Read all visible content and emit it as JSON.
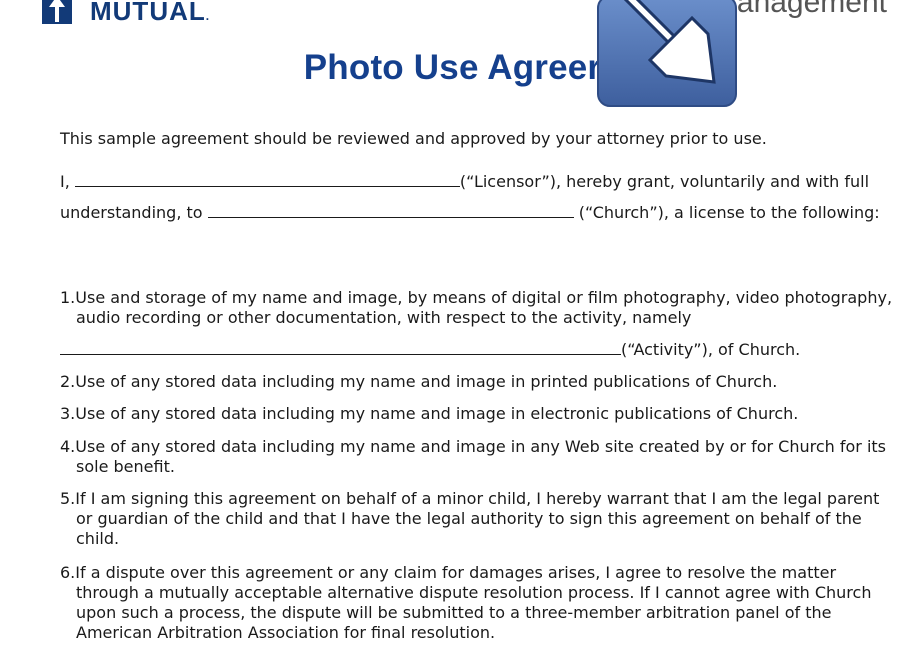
{
  "header": {
    "logo_text": "MUTUAL",
    "logo_dot": ".",
    "right_text": "M                 Management"
  },
  "document": {
    "title": "Photo Use Agreer",
    "intro": "This sample agreement should be reviewed and approved by your attorney prior to use.",
    "line1_start": "I,",
    "line1_end": "(“Licensor”), hereby grant, voluntarily and with full",
    "line2_start": "understanding, to",
    "line2_end": "(“Church”), a license to the following:",
    "activity_end": "(“Activity”), of Church.",
    "items": [
      "1.Use and storage of my name and image, by means of digital or film photography, video photography, audio recording or other documentation, with respect to the activity, namely",
      "2.Use of any stored data including my name and image in printed publications of Church.",
      "3.Use of any stored data including my name and image in electronic publications of Church.",
      "4.Use of any stored data including my name and image in any Web site created by or for Church for its sole benefit.",
      "5.If I am signing this agreement on behalf of a minor child, I hereby warrant that I am the legal parent or guardian of the child and that I have the legal authority to sign this agreement on behalf of the child.",
      "6.If a dispute over this agreement or any claim for damages arises, I agree to resolve the matter through a mutually acceptable alternative dispute resolution process.  If I cannot agree with Church upon such a process, the dispute will be submitted to a three-member arbitration panel of the American Arbitration Association for final resolution."
    ]
  },
  "colors": {
    "brand_blue": "#15408d",
    "logo_blue": "#123a78",
    "overlay_blue": "#4a6fb0"
  },
  "icons": {
    "overlay": "resize-arrow-icon",
    "logo": "logo-mark-icon"
  }
}
